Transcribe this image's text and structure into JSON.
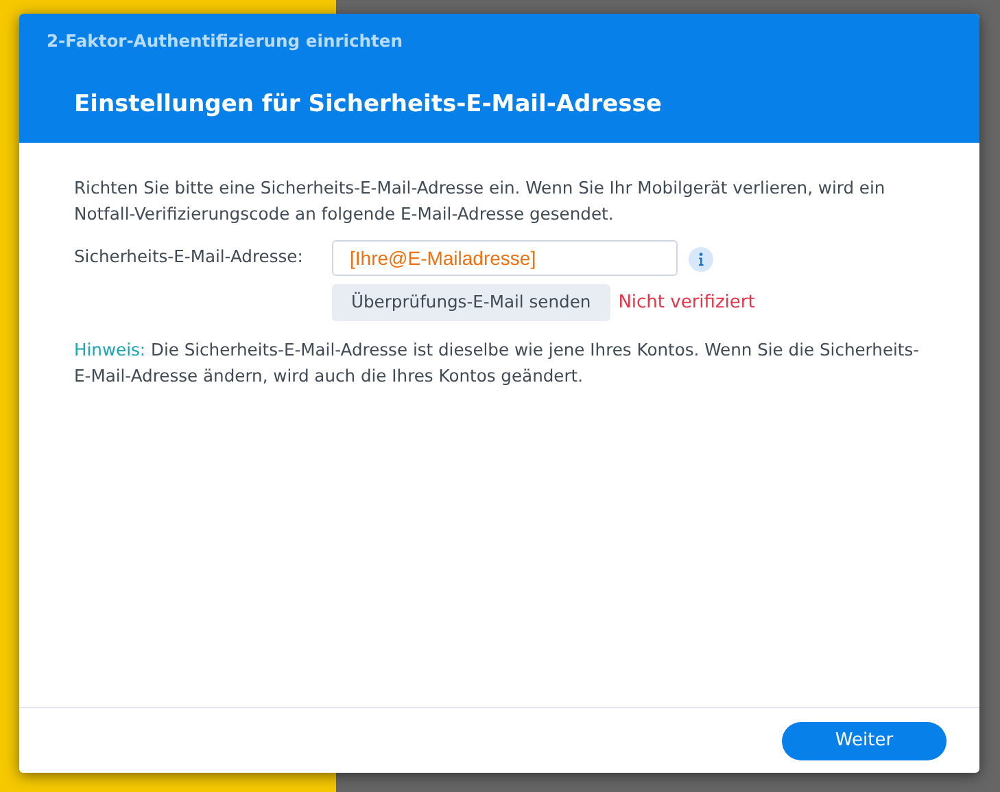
{
  "window": {
    "title": "2-Faktor-Authentifizierung einrichten",
    "heading": "Einstellungen für Sicherheits-E-Mail-Adresse"
  },
  "intro": "Richten Sie bitte eine Sicherheits-E-Mail-Adresse ein. Wenn Sie Ihr Mobilgerät verlieren, wird ein Notfall-Verifizierungscode an folgende E-Mail-Adresse gesendet.",
  "email_field": {
    "label": "Sicherheits-E-Mail-Adresse:",
    "value": "[Ihre@E-Mailadresse]"
  },
  "send_button": "Überprüfungs-E-Mail senden",
  "status": {
    "text": "Nicht verifiziert",
    "verified": false
  },
  "note": {
    "label": "Hinweis:",
    "text": "Die Sicherheits-E-Mail-Adresse ist dieselbe wie jene Ihres Kontos. Wenn Sie die Sicherheits-E-Mail-Adresse ändern, wird auch die Ihres Kontos geändert."
  },
  "footer": {
    "button": "Weiter"
  }
}
